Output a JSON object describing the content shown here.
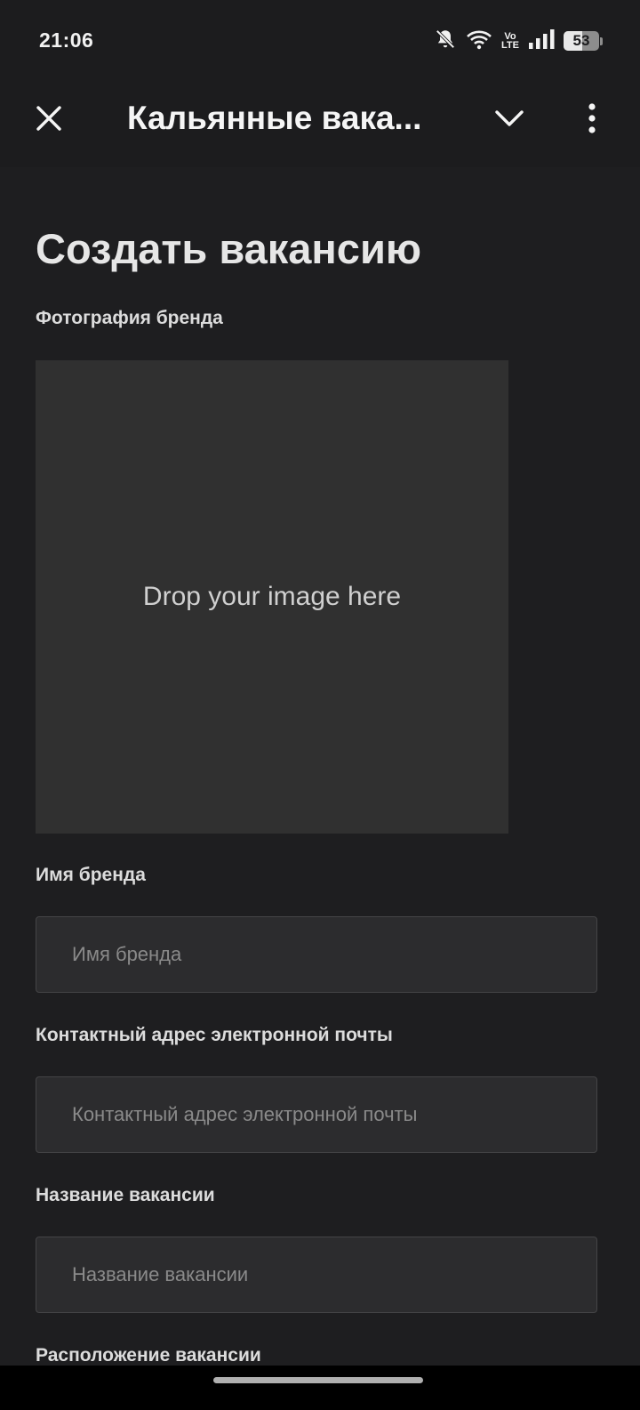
{
  "status_bar": {
    "time": "21:06",
    "volte_top": "Vo",
    "volte_bottom": "LTE",
    "battery_level": "53",
    "icons": [
      "bell-off-icon",
      "wifi-icon",
      "volte-icon",
      "signal-icon",
      "battery-icon"
    ]
  },
  "top_bar": {
    "title": "Кальянные вака...",
    "close_icon": "close-icon",
    "collapse_icon": "chevron-down-icon",
    "menu_icon": "more-vertical-icon"
  },
  "form": {
    "title": "Создать вакансию",
    "photo_label": "Фотография бренда",
    "dropzone_text": "Drop your image here",
    "brand_name_label": "Имя бренда",
    "brand_name_placeholder": "Имя бренда",
    "brand_name_value": "",
    "email_label": "Контактный адрес электронной почты",
    "email_placeholder": "Контактный адрес электронной почты",
    "email_value": "",
    "vacancy_title_label": "Название вакансии",
    "vacancy_title_placeholder": "Название вакансии",
    "vacancy_title_value": "",
    "location_label": "Расположение вакансии"
  },
  "colors": {
    "background": "#1e1e20",
    "header": "#1c1c1e",
    "input_bg": "#2c2c2e",
    "dropzone_bg": "#303030",
    "text_primary": "#e6e6e6",
    "placeholder": "#8a8a8a"
  }
}
